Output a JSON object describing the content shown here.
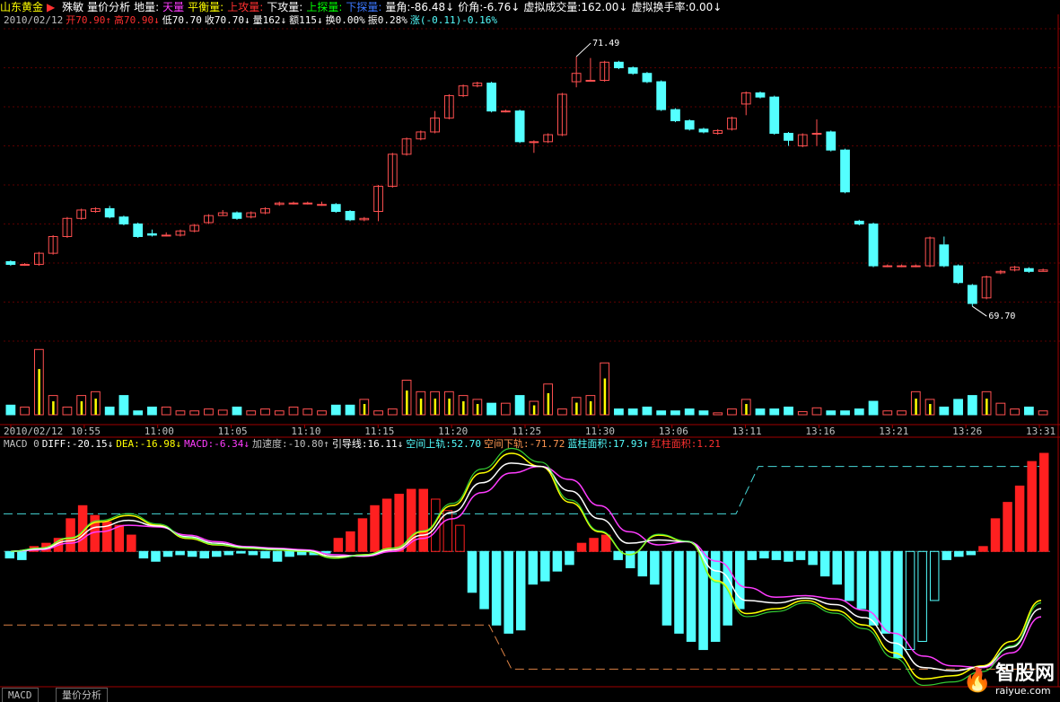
{
  "header": {
    "stock_name": "山东黄金",
    "play_icon": "play-triangle-icon",
    "items": [
      {
        "label": "殊敏",
        "color": "#ffffff"
      },
      {
        "label": "量价分析",
        "color": "#ffffff"
      },
      {
        "label": "地量:",
        "color": "#ffffff"
      },
      {
        "label": "天量",
        "color": "#ff3cff"
      },
      {
        "label": "平衡量:",
        "color": "#ffff00"
      },
      {
        "label": "上攻量:",
        "color": "#ff3030"
      },
      {
        "label": "下攻量:",
        "color": "#ffffff"
      },
      {
        "label": "上探量:",
        "color": "#00ff00"
      },
      {
        "label": "下探量:",
        "color": "#3c78ff"
      },
      {
        "label": "量角:-86.48↓",
        "color": "#ffffff"
      },
      {
        "label": "价角:-6.76↓",
        "color": "#ffffff"
      },
      {
        "label": "虚拟成交量:162.00↓",
        "color": "#ffffff"
      },
      {
        "label": "虚拟换手率:0.00↓",
        "color": "#ffffff"
      }
    ]
  },
  "info_line": [
    {
      "text": "2010/02/12",
      "color": "#c0c0c0"
    },
    {
      "text": "开70.90↑",
      "color": "#ff3030"
    },
    {
      "text": "高70.90↓",
      "color": "#ff3030"
    },
    {
      "text": "低70.70",
      "color": "#ffffff"
    },
    {
      "text": "收70.70↓",
      "color": "#ffffff"
    },
    {
      "text": "量162↓",
      "color": "#ffffff"
    },
    {
      "text": "额115↓",
      "color": "#ffffff"
    },
    {
      "text": "换0.00%",
      "color": "#ffffff"
    },
    {
      "text": "振0.28%",
      "color": "#ffffff"
    },
    {
      "text": "涨(-0.11)-0.16%",
      "color": "#54ffff"
    }
  ],
  "macd_line": [
    {
      "text": "MACD 0",
      "color": "#c0c0c0"
    },
    {
      "text": "DIFF:-20.15↓",
      "color": "#ffffff"
    },
    {
      "text": "DEA:-16.98↓",
      "color": "#ffff00"
    },
    {
      "text": "MACD:-6.34↓",
      "color": "#ff3cff"
    },
    {
      "text": "加速度:-10.80↑",
      "color": "#c0c0c0"
    },
    {
      "text": "引导线:16.11↓",
      "color": "#ffffff"
    },
    {
      "text": "空间上轨:52.70",
      "color": "#54ffff"
    },
    {
      "text": "空间下轨:-71.72",
      "color": "#ff9650"
    },
    {
      "text": "蓝柱面积:17.93↑",
      "color": "#54ffff"
    },
    {
      "text": "红柱面积:1.21",
      "color": "#ff3030"
    }
  ],
  "tabs": [
    "MACD",
    "量价分析"
  ],
  "logo": {
    "cn": "智股网",
    "url": "raiyue.com"
  },
  "colors": {
    "up": "#ff5050",
    "down": "#54ffff",
    "bg": "#000000",
    "grid": "#800000"
  },
  "chart_data": [
    {
      "type": "candlestick",
      "date": "2010/02/12",
      "x_ticks": [
        "2010/02/12",
        "10:55",
        "11:00",
        "11:05",
        "11:10",
        "11:15",
        "11:20",
        "11:25",
        "11:30",
        "13:06",
        "13:11",
        "13:16",
        "13:21",
        "13:26",
        "13:31"
      ],
      "annotations": [
        {
          "label": "71.49",
          "index": 40
        },
        {
          "label": "69.70",
          "index": 68
        }
      ],
      "ylim": [
        69.45,
        71.69
      ],
      "candles": [
        {
          "o": 70.02,
          "c": 70.0,
          "h": 70.03,
          "l": 69.99
        },
        {
          "o": 70.0,
          "c": 70.0,
          "h": 70.01,
          "l": 69.99
        },
        {
          "o": 70.0,
          "c": 70.08,
          "h": 70.09,
          "l": 69.99
        },
        {
          "o": 70.08,
          "c": 70.2,
          "h": 70.21,
          "l": 70.07
        },
        {
          "o": 70.2,
          "c": 70.33,
          "h": 70.34,
          "l": 70.19
        },
        {
          "o": 70.33,
          "c": 70.39,
          "h": 70.4,
          "l": 70.32
        },
        {
          "o": 70.38,
          "c": 70.4,
          "h": 70.41,
          "l": 70.37
        },
        {
          "o": 70.4,
          "c": 70.34,
          "h": 70.42,
          "l": 70.33
        },
        {
          "o": 70.34,
          "c": 70.29,
          "h": 70.35,
          "l": 70.28
        },
        {
          "o": 70.29,
          "c": 70.2,
          "h": 70.3,
          "l": 70.19
        },
        {
          "o": 70.22,
          "c": 70.21,
          "h": 70.25,
          "l": 70.2
        },
        {
          "o": 70.21,
          "c": 70.21,
          "h": 70.23,
          "l": 70.2
        },
        {
          "o": 70.21,
          "c": 70.24,
          "h": 70.25,
          "l": 70.2
        },
        {
          "o": 70.24,
          "c": 70.28,
          "h": 70.29,
          "l": 70.23
        },
        {
          "o": 70.3,
          "c": 70.35,
          "h": 70.36,
          "l": 70.29
        },
        {
          "o": 70.35,
          "c": 70.37,
          "h": 70.39,
          "l": 70.35
        },
        {
          "o": 70.37,
          "c": 70.33,
          "h": 70.38,
          "l": 70.32
        },
        {
          "o": 70.34,
          "c": 70.37,
          "h": 70.38,
          "l": 70.33
        },
        {
          "o": 70.37,
          "c": 70.4,
          "h": 70.41,
          "l": 70.36
        },
        {
          "o": 70.43,
          "c": 70.44,
          "h": 70.45,
          "l": 70.42
        },
        {
          "o": 70.44,
          "c": 70.44,
          "h": 70.45,
          "l": 70.43
        },
        {
          "o": 70.44,
          "c": 70.44,
          "h": 70.45,
          "l": 70.43
        },
        {
          "o": 70.43,
          "c": 70.43,
          "h": 70.45,
          "l": 70.42
        },
        {
          "o": 70.43,
          "c": 70.38,
          "h": 70.44,
          "l": 70.37
        },
        {
          "o": 70.38,
          "c": 70.32,
          "h": 70.39,
          "l": 70.31
        },
        {
          "o": 70.32,
          "c": 70.33,
          "h": 70.34,
          "l": 70.31
        },
        {
          "o": 70.38,
          "c": 70.56,
          "h": 70.57,
          "l": 70.31
        },
        {
          "o": 70.56,
          "c": 70.79,
          "h": 70.8,
          "l": 70.55
        },
        {
          "o": 70.79,
          "c": 70.9,
          "h": 70.91,
          "l": 70.78
        },
        {
          "o": 70.9,
          "c": 70.95,
          "h": 70.96,
          "l": 70.89
        },
        {
          "o": 70.95,
          "c": 71.05,
          "h": 71.1,
          "l": 70.94
        },
        {
          "o": 71.05,
          "c": 71.21,
          "h": 71.22,
          "l": 71.04
        },
        {
          "o": 71.21,
          "c": 71.28,
          "h": 71.29,
          "l": 71.2
        },
        {
          "o": 71.28,
          "c": 71.3,
          "h": 71.31,
          "l": 71.27
        },
        {
          "o": 71.3,
          "c": 71.1,
          "h": 71.31,
          "l": 71.09
        },
        {
          "o": 71.1,
          "c": 71.1,
          "h": 71.11,
          "l": 71.09
        },
        {
          "o": 71.1,
          "c": 70.88,
          "h": 71.11,
          "l": 70.87
        },
        {
          "o": 70.88,
          "c": 70.88,
          "h": 70.89,
          "l": 70.8
        },
        {
          "o": 70.88,
          "c": 70.93,
          "h": 70.94,
          "l": 70.87
        },
        {
          "o": 70.93,
          "c": 71.22,
          "h": 71.23,
          "l": 70.92
        },
        {
          "o": 71.31,
          "c": 71.37,
          "h": 71.49,
          "l": 71.27
        },
        {
          "o": 71.32,
          "c": 71.32,
          "h": 71.48,
          "l": 71.31
        },
        {
          "o": 71.32,
          "c": 71.45,
          "h": 71.46,
          "l": 71.31
        },
        {
          "o": 71.45,
          "c": 71.41,
          "h": 71.46,
          "l": 71.4
        },
        {
          "o": 71.41,
          "c": 71.37,
          "h": 71.42,
          "l": 71.36
        },
        {
          "o": 71.37,
          "c": 71.31,
          "h": 71.38,
          "l": 71.3
        },
        {
          "o": 71.31,
          "c": 71.11,
          "h": 71.32,
          "l": 71.1
        },
        {
          "o": 71.11,
          "c": 71.03,
          "h": 71.12,
          "l": 71.02
        },
        {
          "o": 71.03,
          "c": 70.97,
          "h": 71.04,
          "l": 70.96
        },
        {
          "o": 70.97,
          "c": 70.95,
          "h": 70.98,
          "l": 70.94
        },
        {
          "o": 70.94,
          "c": 70.96,
          "h": 70.97,
          "l": 70.93
        },
        {
          "o": 70.97,
          "c": 71.05,
          "h": 71.06,
          "l": 70.96
        },
        {
          "o": 71.15,
          "c": 71.23,
          "h": 71.24,
          "l": 71.07
        },
        {
          "o": 71.23,
          "c": 71.2,
          "h": 71.24,
          "l": 71.19
        },
        {
          "o": 71.2,
          "c": 70.94,
          "h": 71.21,
          "l": 70.93
        },
        {
          "o": 70.94,
          "c": 70.89,
          "h": 70.95,
          "l": 70.85
        },
        {
          "o": 70.85,
          "c": 70.93,
          "h": 70.94,
          "l": 70.84
        },
        {
          "o": 70.94,
          "c": 70.94,
          "h": 71.04,
          "l": 70.85
        },
        {
          "o": 70.95,
          "c": 70.82,
          "h": 70.96,
          "l": 70.81
        },
        {
          "o": 70.82,
          "c": 70.52,
          "h": 70.83,
          "l": 70.51
        },
        {
          "o": 70.31,
          "c": 70.29,
          "h": 70.32,
          "l": 70.28
        },
        {
          "o": 70.29,
          "c": 69.99,
          "h": 70.3,
          "l": 69.98
        },
        {
          "o": 69.99,
          "c": 69.99,
          "h": 70.0,
          "l": 69.98
        },
        {
          "o": 69.99,
          "c": 69.99,
          "h": 70.0,
          "l": 69.98
        },
        {
          "o": 69.99,
          "c": 69.99,
          "h": 70.0,
          "l": 69.98
        },
        {
          "o": 69.99,
          "c": 70.19,
          "h": 70.2,
          "l": 69.98
        },
        {
          "o": 70.14,
          "c": 69.99,
          "h": 70.2,
          "l": 69.98
        },
        {
          "o": 69.99,
          "c": 69.87,
          "h": 70.0,
          "l": 69.86
        },
        {
          "o": 69.85,
          "c": 69.72,
          "h": 69.86,
          "l": 69.7
        },
        {
          "o": 69.76,
          "c": 69.91,
          "h": 69.92,
          "l": 69.75
        },
        {
          "o": 69.94,
          "c": 69.95,
          "h": 69.96,
          "l": 69.93
        },
        {
          "o": 69.96,
          "c": 69.98,
          "h": 69.99,
          "l": 69.95
        },
        {
          "o": 69.97,
          "c": 69.95,
          "h": 69.98,
          "l": 69.94
        },
        {
          "o": 69.95,
          "c": 69.96,
          "h": 69.97,
          "l": 69.95
        }
      ]
    },
    {
      "type": "bar",
      "name": "volume",
      "values": [
        25,
        20,
        170,
        50,
        20,
        50,
        60,
        20,
        50,
        10,
        20,
        20,
        10,
        10,
        15,
        12,
        20,
        10,
        15,
        10,
        20,
        15,
        10,
        25,
        25,
        40,
        10,
        15,
        90,
        60,
        60,
        60,
        50,
        40,
        30,
        30,
        50,
        35,
        80,
        15,
        45,
        50,
        135,
        15,
        15,
        20,
        10,
        10,
        15,
        10,
        5,
        15,
        40,
        15,
        15,
        20,
        8,
        18,
        10,
        10,
        15,
        35,
        10,
        10,
        60,
        40,
        20,
        40,
        50,
        60,
        30,
        15,
        20,
        10,
        8
      ]
    },
    {
      "type": "line",
      "name": "MACD",
      "ylim": [
        -80,
        60
      ],
      "bars": [
        -4,
        -5,
        3,
        5,
        8,
        20,
        28,
        22,
        18,
        16,
        10,
        -4,
        -6,
        -3,
        -2,
        -3,
        -4,
        -3,
        -2,
        -1,
        -2,
        -4,
        -6,
        -3,
        -2,
        -2,
        -1,
        8,
        12,
        20,
        28,
        32,
        35,
        38,
        38,
        32,
        25,
        16,
        -25,
        -35,
        -45,
        -50,
        -48,
        -20,
        -18,
        -12,
        -8,
        5,
        8,
        10,
        -5,
        -10,
        -15,
        -20,
        -45,
        -50,
        -55,
        -60,
        -55,
        -45,
        -35,
        -5,
        -4,
        -5,
        -6,
        -5,
        -8,
        -15,
        -20,
        -30,
        -35,
        -45,
        -50,
        -65,
        -60,
        -55,
        -30,
        -5,
        -3,
        -2,
        3,
        20,
        30,
        40,
        55,
        60
      ]
    }
  ]
}
